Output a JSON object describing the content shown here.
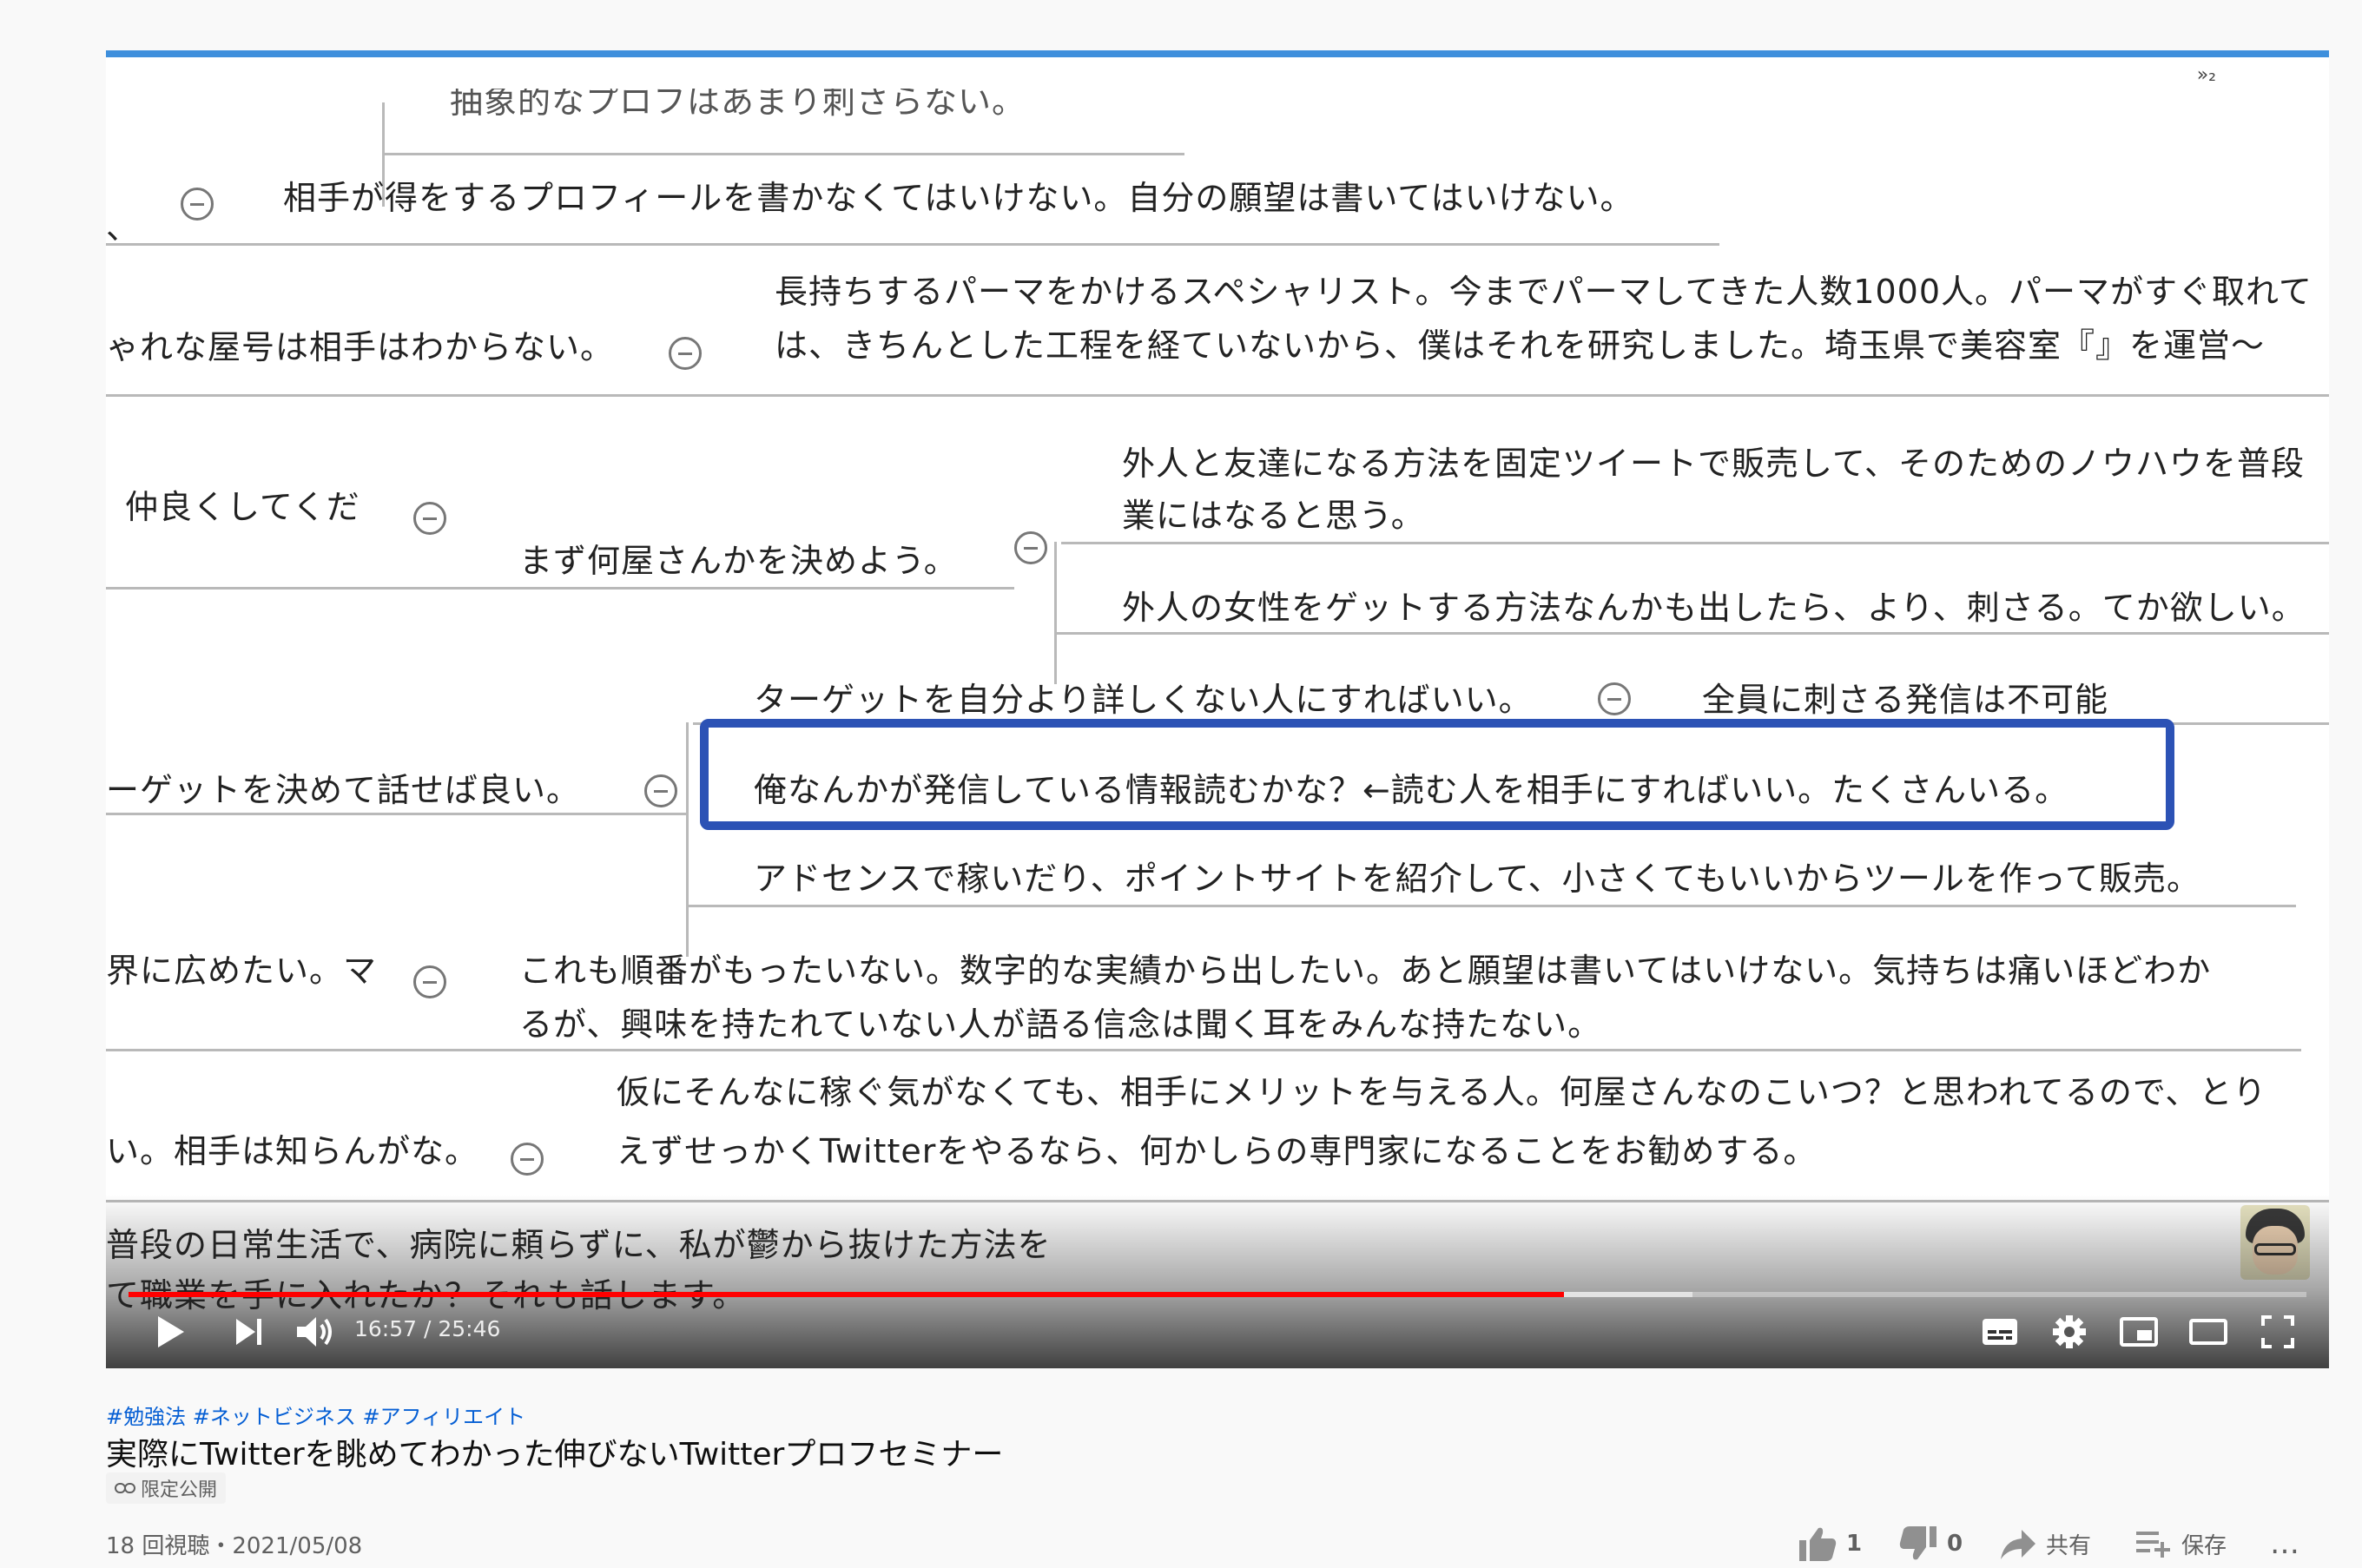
{
  "player": {
    "corner_mark": "»₂",
    "mindmap": {
      "partial_top": "抽象的なプロフはあまり刺さらない。",
      "r1_left": "、",
      "r1_text": "相手が得をするプロフィールを書かなくてはいけない。自分の願望は書いてはいけない。",
      "r2_left": "ゃれな屋号は相手はわからない。",
      "r2_line1": "長持ちするパーマをかけるスペシャリスト。今までパーマしてきた人数1000人。パーマがすぐ取れて",
      "r2_line2": "は、きちんとした工程を経ていないから、僕はそれを研究しました。埼玉県で美容室『』を運営〜",
      "r3_left": "仲良くしてくだ",
      "r3_mid": "まず何屋さんかを決めよう。",
      "r3_a1": "外人と友達になる方法を固定ツイートで販売して、そのためのノウハウを普段",
      "r3_a2": "業にはなると思う。",
      "r3_b": "外人の女性をゲットする方法なんかも出したら、より、刺さる。てか欲しい。",
      "r4_top": "ターゲットを自分より詳しくない人にすればいい。",
      "r4_top_right": "全員に刺さる発信は不可能",
      "r4_left": "ーゲットを決めて話せば良い。",
      "r4_highlight": "俺なんかが発信している情報読むかな？←読む人を相手にすればいい。たくさんいる。",
      "r4_bottom": "アドセンスで稼いだり、ポイントサイトを紹介して、小さくてもいいからツールを作って販売。",
      "r5_left": "界に広めたい。マ",
      "r5_line1": "これも順番がもったいない。数字的な実績から出したい。あと願望は書いてはいけない。気持ちは痛いほどわか",
      "r5_line2": "るが、興味を持たれていない人が語る信念は聞く耳をみんな持たない。",
      "r6_left": "い。相手は知らんがな。",
      "r6_line1": "仮にそんなに稼ぐ気がなくても、相手にメリットを与える人。何屋さんなのこいつ？と思われてるので、とり",
      "r6_line2": "えずせっかくTwitterをやるなら、何かしらの専門家になることをお勧めする。"
    },
    "overlay_line1": "普段の日常生活で、病院に頼らずに、私が鬱から抜けた方法を",
    "overlay_line2": "て職業を手に入れたか？それも話します。",
    "progress": {
      "played_fraction": 0.659,
      "buffered_fraction": 0.718
    },
    "time_display": "16:57 / 25:46",
    "icons": {
      "play": "play-icon",
      "next": "next-icon",
      "volume": "volume-icon",
      "subtitles": "subtitles-icon",
      "settings": "gear-icon",
      "miniplayer": "miniplayer-icon",
      "theater": "theater-icon",
      "fullscreen": "fullscreen-icon"
    }
  },
  "video": {
    "hashtags": "#勉強法 #ネットビジネス #アフィリエイト",
    "title": "実際にTwitterを眺めてわかった伸びないTwitterプロフセミナー",
    "visibility": "限定公開",
    "stats": "18 回視聴・2021/05/08"
  },
  "actions": {
    "like_count": "1",
    "dislike_count": "0",
    "share_label": "共有",
    "save_label": "保存",
    "more_label": "…"
  },
  "colors": {
    "accent_blue": "#2c52b5",
    "progress_red": "#ff0000",
    "link": "#065fd4"
  }
}
